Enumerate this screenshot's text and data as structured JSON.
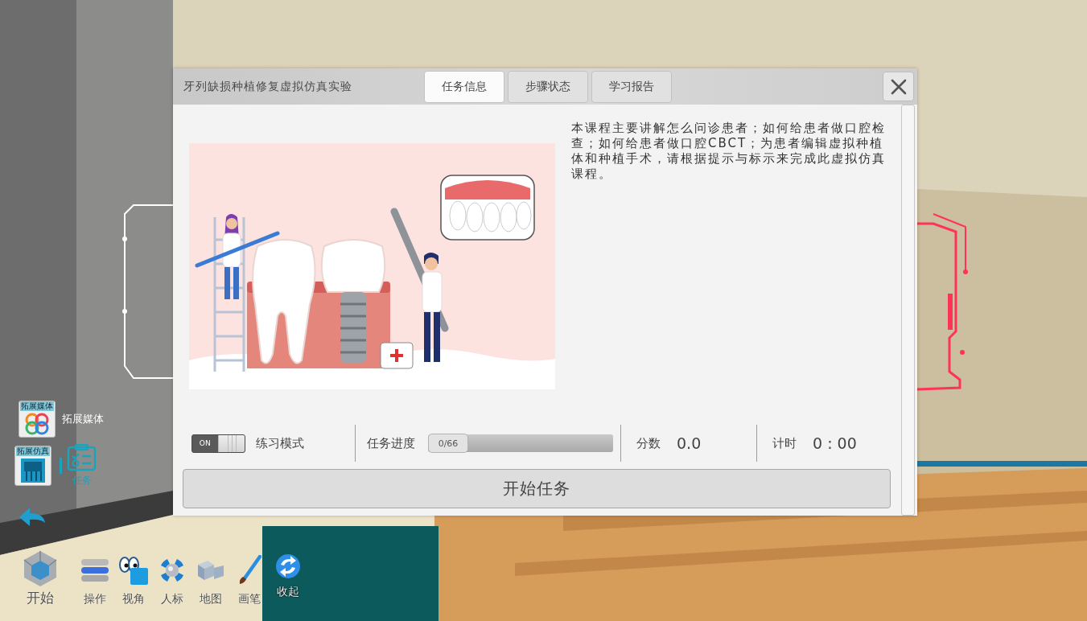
{
  "dialog": {
    "title": "牙列缺损种植修复虚拟仿真实验",
    "tabs": [
      {
        "label": "任务信息",
        "selected": true
      },
      {
        "label": "步骤状态",
        "selected": false
      },
      {
        "label": "学习报告",
        "selected": false
      }
    ],
    "description": "本课程主要讲解怎么问诊患者；如何给患者做口腔检查；如何给患者做口腔CBCT；为患者编辑虚拟种植体和种植手术，请根据提示与标示来完成此虚拟仿真课程。",
    "practice_mode": {
      "switch_text": "ON",
      "on": true,
      "label": "练习模式"
    },
    "progress": {
      "label": "任务进度",
      "reading": "0/66",
      "level": 0
    },
    "score": {
      "label": "分数",
      "value": "0.0"
    },
    "timer": {
      "label": "计时",
      "value": "0 : 00"
    },
    "start_button": {
      "label": "开始任务"
    }
  },
  "side_panel": {
    "media": {
      "tile_caption": "拓展媒体",
      "label": "拓展媒体"
    },
    "simulation": {
      "tile_caption": "拓展仿真"
    },
    "task": {
      "label": "任务",
      "active": true
    }
  },
  "toolbar": [
    {
      "kind": "start",
      "label": "开始"
    },
    {
      "kind": "operate",
      "label": "操作"
    },
    {
      "kind": "view",
      "label": "视角"
    },
    {
      "kind": "marker",
      "label": "人标"
    },
    {
      "kind": "map",
      "label": "地图"
    },
    {
      "kind": "brush",
      "label": "画笔"
    },
    {
      "kind": "collapse",
      "label": "收起"
    }
  ]
}
